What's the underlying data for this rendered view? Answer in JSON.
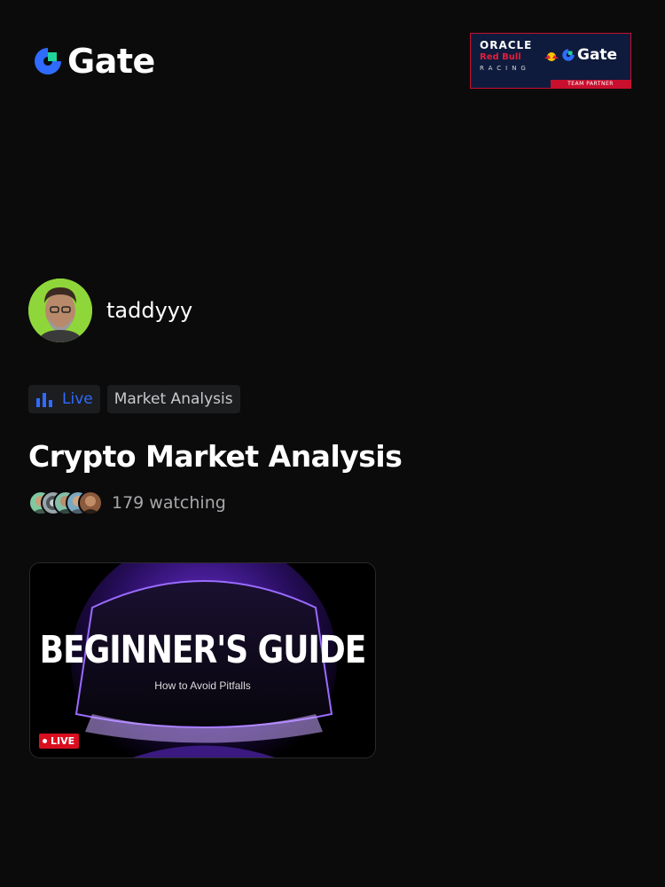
{
  "brand": {
    "name": "Gate"
  },
  "partner": {
    "line1": "ORACLE",
    "line2": "Red Bull",
    "line3": "RACING",
    "brand": "Gate",
    "tag": "TEAM PARTNER"
  },
  "host": {
    "name": "taddyyy"
  },
  "tags": {
    "live": "Live",
    "topic": "Market Analysis"
  },
  "stream": {
    "title": "Crypto Market Analysis",
    "watching": "179 watching"
  },
  "card": {
    "headline": "BEGINNER'S GUIDE",
    "subtitle": "How to Avoid Pitfalls",
    "badge": "LIVE"
  },
  "colors": {
    "background": "#0b0b0c",
    "brand_blue": "#2f6bff",
    "brand_green": "#1fd39a",
    "live_red": "#d90f1f",
    "avatar_green": "#8fd63a"
  },
  "icons": {
    "live": "bar-chart-icon",
    "badge": "dot-icon"
  }
}
